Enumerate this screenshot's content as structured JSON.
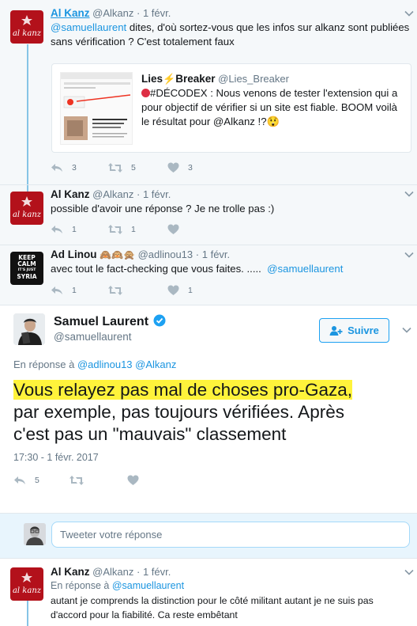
{
  "tweets": [
    {
      "name": "Al Kanz",
      "handle": "@Alkanz",
      "dot": "·",
      "date": "1 févr.",
      "mention": "@samuellaurent",
      "text_after_mention": " dites, d'où sortez-vous que les infos sur alkanz sont publiées",
      "text_line2": "sans vérification ? C'est totalement faux",
      "quote": {
        "name": "Lies",
        "name_emoji": "⚡",
        "name_rest": "Breaker",
        "handle": "@Lies_Breaker",
        "line1": "#DÉCODEX : Nous venons de tester l'extension qui a",
        "line2": "pour objectif de vérifier si un site est fiable. BOOM voilà",
        "line3_prefix": "le résultat pour ",
        "line3_mention": "@Alkanz",
        "line3_suffix": " !?",
        "emoji_end": "😲"
      },
      "replies": "3",
      "retweets": "5",
      "likes": "3"
    },
    {
      "name": "Al Kanz",
      "handle": "@Alkanz",
      "dot": "·",
      "date": "1 févr.",
      "text": "possible d'avoir une réponse ? Je ne trolle pas :)",
      "replies": "1",
      "retweets": "1",
      "likes": ""
    },
    {
      "name": "Ad Linou",
      "name_emojis": "🙈🙉🙊",
      "handle": "@adlinou13",
      "dot": "·",
      "date": "1 févr.",
      "avatar_lines": [
        "KEEP",
        "CALM",
        "IT'S JUST",
        "SYRIA"
      ],
      "text": "avec tout le fact-checking que vous faites. .....  ",
      "mention": "@samuellaurent",
      "replies": "1",
      "retweets": "",
      "likes": "1"
    }
  ],
  "main_tweet": {
    "name": "Samuel Laurent",
    "handle": "@samuellaurent",
    "follow_label": "Suivre",
    "reply_prefix": "En réponse à ",
    "reply_to_1": "@adlinou13",
    "reply_to_2": "@Alkanz",
    "text_highlight": "Vous relayez pas mal de choses pro-Gaza,",
    "text_line2": "par exemple, pas toujours vérifiées. Après",
    "text_line3": "c'est pas un \"mauvais\" classement",
    "timestamp": "17:30 - 1 févr. 2017",
    "replies": "5"
  },
  "reply_box": {
    "placeholder": "Tweeter votre réponse"
  },
  "last_tweet": {
    "name": "Al Kanz",
    "handle": "@Alkanz",
    "dot": "·",
    "date": "1 févr.",
    "reply_prefix": "En réponse à ",
    "reply_to": "@samuellaurent",
    "line1": "autant je comprends la distinction pour le côté militant autant je ne suis pas",
    "line2": "d'accord pour la fiabilité. Ca reste embêtant"
  },
  "avatar_alkanz_text": "al kanz",
  "colors": {
    "accent": "#1b95e0",
    "brand_red": "#b3111b",
    "highlight": "#fff33b",
    "thread_line": "#86c4e6"
  }
}
